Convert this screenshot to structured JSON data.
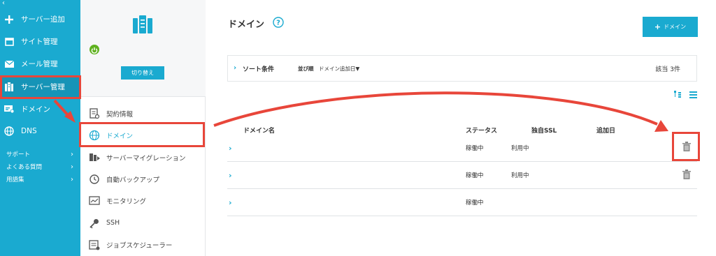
{
  "sidebar": {
    "collapse_glyph": "‹",
    "items": [
      {
        "label": "サーバー追加",
        "icon": "plus-icon"
      },
      {
        "label": "サイト管理",
        "icon": "window-icon"
      },
      {
        "label": "メール管理",
        "icon": "envelope-icon"
      },
      {
        "label": "サーバー管理",
        "icon": "server-icon"
      },
      {
        "label": "ドメイン",
        "icon": "domain-card-icon"
      },
      {
        "label": "DNS",
        "icon": "globe-icon"
      }
    ],
    "sub_links": [
      {
        "label": "サポート",
        "chevron": "›"
      },
      {
        "label": "よくある質問",
        "chevron": "›"
      },
      {
        "label": "用語集",
        "chevron": "›"
      }
    ]
  },
  "server_panel": {
    "switch_label": "切り替え",
    "menu": [
      {
        "label": "契約情報",
        "icon": "contract-icon"
      },
      {
        "label": "ドメイン",
        "icon": "globe-icon"
      },
      {
        "label": "サーバーマイグレーション",
        "icon": "migration-icon"
      },
      {
        "label": "自動バックアップ",
        "icon": "backup-clock-icon"
      },
      {
        "label": "モニタリング",
        "icon": "monitor-chart-icon"
      },
      {
        "label": "SSH",
        "icon": "key-icon"
      },
      {
        "label": "ジョブスケジューラー",
        "icon": "scheduler-icon"
      }
    ]
  },
  "main": {
    "title": "ドメイン",
    "add_button": {
      "plus": "+",
      "label": "ドメイン"
    },
    "sort": {
      "chevron": "›",
      "label": "ソート条件",
      "order_label": "並び順",
      "order_value": "ドメイン追加日▼",
      "count_text": "該当 3件"
    },
    "table": {
      "headers": {
        "name": "ドメイン名",
        "status": "ステータス",
        "ssl": "独自SSL",
        "added": "追加日"
      },
      "rows": [
        {
          "chevron": "›",
          "status": "稼働中",
          "ssl": "利用中"
        },
        {
          "chevron": "›",
          "status": "稼働中",
          "ssl": "利用中"
        },
        {
          "chevron": "›",
          "status": "稼働中",
          "ssl": ""
        }
      ]
    }
  },
  "colors": {
    "accent": "#1aaad0",
    "annotation": "#e8463a",
    "power": "#5fb11f"
  }
}
